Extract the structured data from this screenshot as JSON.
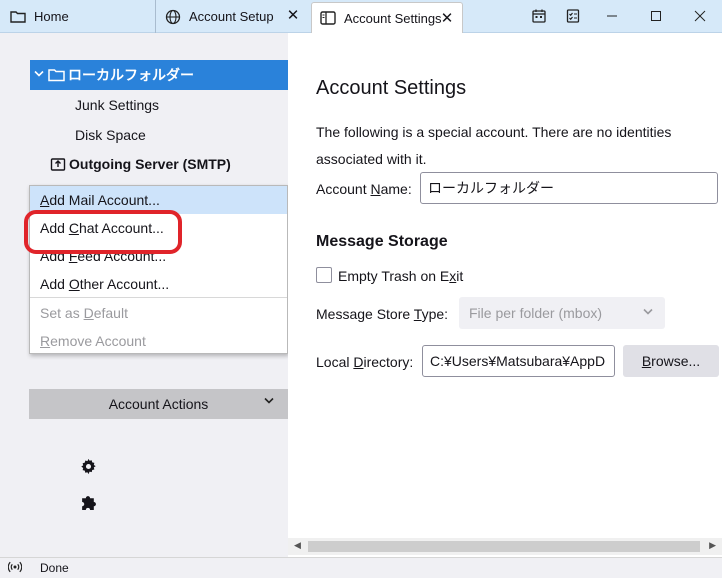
{
  "tabs": [
    {
      "label": "Home"
    },
    {
      "label": "Account Setup",
      "close": "✕"
    },
    {
      "label": "Account Settings",
      "close": "✕"
    }
  ],
  "sidebar": {
    "root_label": "ローカルフォルダー",
    "items": [
      {
        "label": "Junk Settings"
      },
      {
        "label": "Disk Space"
      }
    ],
    "smtp_label": "Outgoing Server (SMTP)"
  },
  "menu": {
    "items": [
      {
        "pre": "",
        "key": "A",
        "post": "dd Mail Account..."
      },
      {
        "pre": "Add ",
        "key": "C",
        "post": "hat Account..."
      },
      {
        "pre": "Add ",
        "key": "F",
        "post": "eed Account..."
      },
      {
        "pre": "Add ",
        "key": "O",
        "post": "ther Account..."
      }
    ],
    "disabled_items": [
      {
        "pre": "Set as ",
        "key": "D",
        "post": "efault"
      },
      {
        "pre": "",
        "key": "R",
        "post": "emove Account"
      }
    ]
  },
  "account_actions_label": "Account Actions",
  "main": {
    "title": "Account Settings",
    "description": "The following is a special account. There are no identities associated with it.",
    "account_name": {
      "pre": "Account ",
      "key": "N",
      "post": "ame:",
      "value": "ローカルフォルダー"
    },
    "message_storage_title": "Message Storage",
    "empty_trash": {
      "pre": "Empty Trash on E",
      "key": "x",
      "post": "it"
    },
    "store_type": {
      "pre": "Message Store ",
      "key": "T",
      "post": "ype:",
      "value": "File per folder (mbox)"
    },
    "local_directory": {
      "pre": "Local ",
      "key": "D",
      "post": "irectory:",
      "value": "C:¥Users¥Matsubara¥AppD"
    },
    "browse": {
      "pre": "",
      "key": "B",
      "post": "rowse..."
    }
  },
  "status": {
    "text": "Done"
  }
}
